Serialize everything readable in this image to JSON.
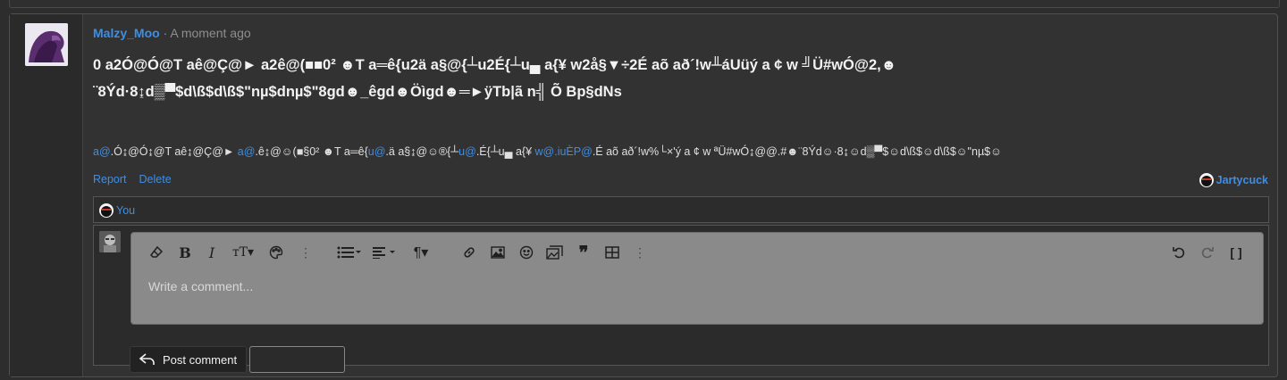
{
  "post": {
    "username": "Malzy_Moo",
    "separator": " · ",
    "time": "A moment ago",
    "body_line1": "0 a2Ó@Ó@T aê@Ç@► a2ê@(■■0² ☻T a═ê{u2ä a§@{┴u2É{┴u▄ a{¥ w2å§▼÷2É aõ að´!w╨áUüý a ¢ w ╝Ü#wÓ@2,☻",
    "body_line2": "¨8Ýd·8↨d▒▀$d\\ß$d\\ß$\"nµ$dnµ$\"8gd☻_êgd☻Öìgd☻═►ÿTb|ã n╣ Õ Bp§dNs",
    "sig": {
      "p1": "a@",
      "p2": ".Ó↨@Ó↨@T aê↨@Ç@► ",
      "p3": "a@",
      "p4": ".ê↨@☺(■§0² ☻T a═ê{",
      "p5": "u@",
      "p6": ".ä a§↨@☺®{┴",
      "p7": "u@",
      "p8": ".É{┴u▄ a{¥ ",
      "p9": "w@.iuÈP@",
      "p10": ".É aõ að´!w%└×'ý a ¢ w ªÜ#wÓ↨@@.#☻¨8Ýd☺·8↨☺d▒▀$☺d\\ß$☺d\\ß$☺\"nµ$☺"
    },
    "actions": {
      "report": "Report",
      "delete": "Delete"
    },
    "reactor": "Jartycuck"
  },
  "reactions": {
    "you": "You"
  },
  "comment": {
    "placeholder": "Write a comment...",
    "post_button": "Post comment"
  },
  "icons": {
    "eraser": "eraser-icon",
    "bold": "B",
    "italic": "I",
    "text_size": "TT",
    "palette": "palette-icon",
    "more": "⋮",
    "list": "list-icon",
    "align": "align-icon",
    "paragraph": "¶",
    "link": "link-icon",
    "image": "image-icon",
    "smilie": "smilie-icon",
    "media": "media-icon",
    "quote": "quote-icon",
    "table": "table-icon",
    "undo": "undo-icon",
    "redo": "redo-icon",
    "fullscreen": "[ ]"
  }
}
